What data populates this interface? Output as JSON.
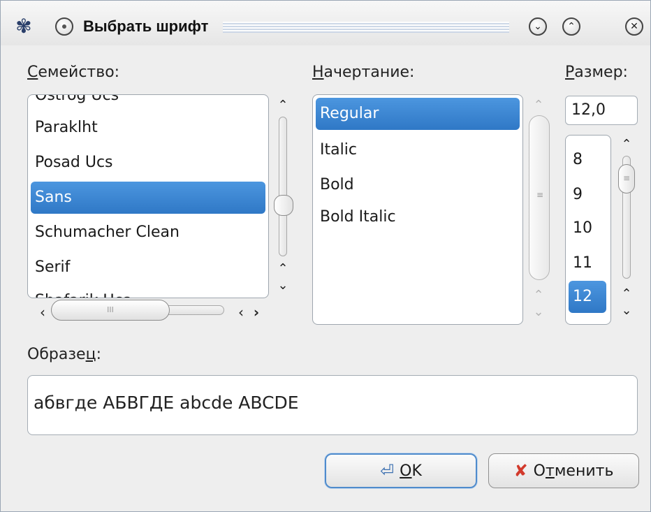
{
  "window": {
    "title": "Выбрать шрифт"
  },
  "labels": {
    "family": "Семейство:",
    "family_underline": "С",
    "family_rest": "емейство:",
    "style_underline": "Н",
    "style_rest": "ачертание:",
    "size_underline": "Р",
    "size_rest": "азмер:",
    "sample_pre": "Образе",
    "sample_underline": "ц",
    "sample_post": ":"
  },
  "family_list": {
    "items": [
      "Ostrog Ucs",
      "Paraklht",
      "Posad Ucs",
      "Sans",
      "Schumacher Clean",
      "Serif",
      "Shafarik Ucs"
    ],
    "selected": "Sans"
  },
  "style_list": {
    "items": [
      "Regular",
      "Italic",
      "Bold",
      "Bold Italic"
    ],
    "selected": "Regular"
  },
  "size": {
    "value": "12,0",
    "items": [
      "8",
      "9",
      "10",
      "11",
      "12"
    ],
    "selected": "12"
  },
  "sample": {
    "text": "абвгде АБВГДЕ abcde ABCDE"
  },
  "buttons": {
    "ok_underline": "O",
    "ok_rest": "K",
    "cancel_pre": "О",
    "cancel_underline": "т",
    "cancel_rest": "менить"
  },
  "scroll_glyphs": {
    "h_grip": "III",
    "v_grip": "≡"
  }
}
